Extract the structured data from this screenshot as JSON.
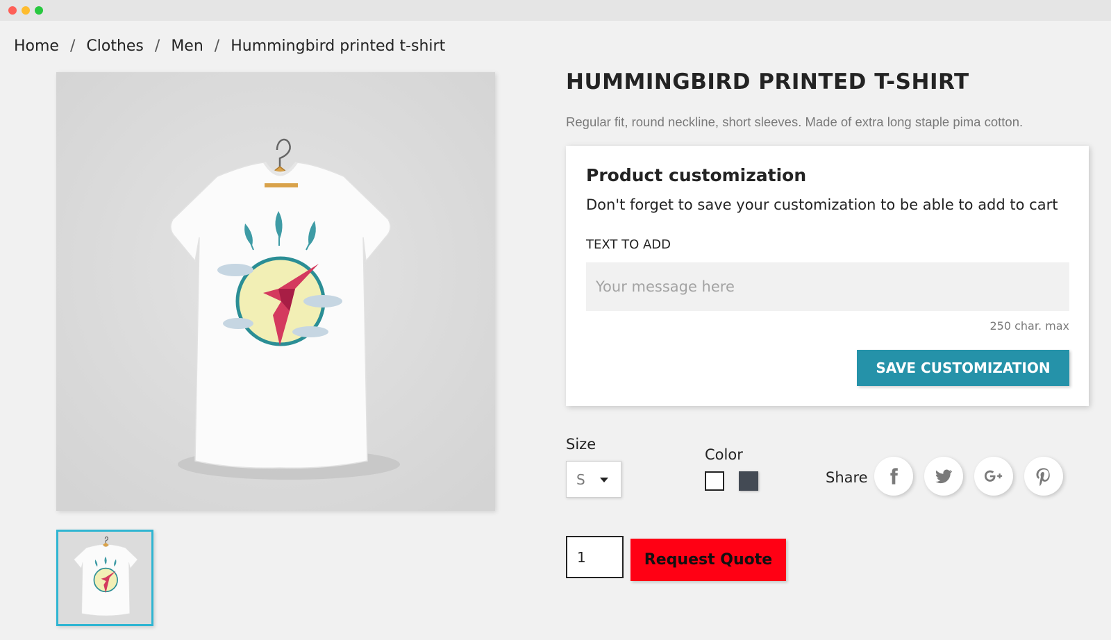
{
  "breadcrumb": [
    "Home",
    "Clothes",
    "Men",
    "Hummingbird printed t-shirt"
  ],
  "product": {
    "title": "HUMMINGBIRD PRINTED T-SHIRT",
    "description": "Regular fit, round neckline, short sleeves. Made of extra long staple pima cotton."
  },
  "customization": {
    "title": "Product customization",
    "note": "Don't forget to save your customization to be able to add to cart",
    "field_label": "TEXT TO ADD",
    "placeholder": "Your message here",
    "char_limit": "250 char. max",
    "save_label": "SAVE CUSTOMIZATION",
    "button_color": "#2592a9"
  },
  "options": {
    "size_label": "Size",
    "size_value": "S",
    "color_label": "Color",
    "colors": [
      "#ffffff",
      "#434a54"
    ]
  },
  "share": {
    "label": "Share",
    "networks": [
      "facebook-icon",
      "twitter-icon",
      "google-plus-icon",
      "pinterest-icon"
    ]
  },
  "cart": {
    "quantity": "1",
    "request_quote_label": "Request Quote",
    "button_color": "#ff0014"
  },
  "accent_color": "#2fb5d2"
}
